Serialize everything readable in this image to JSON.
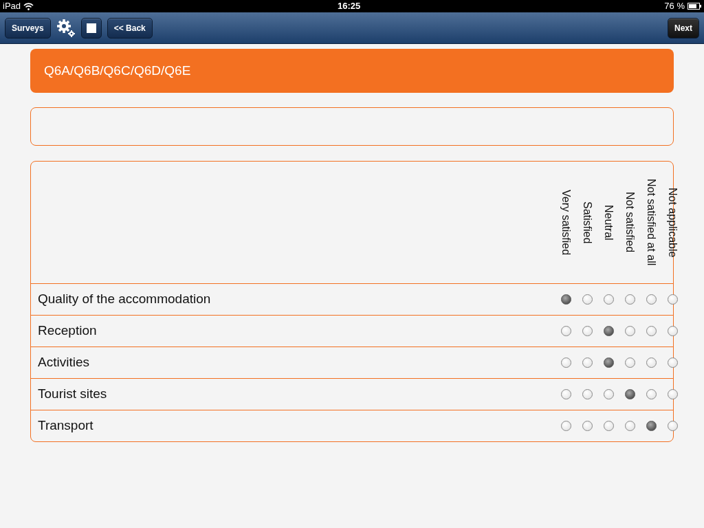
{
  "status_bar": {
    "device": "iPad",
    "time": "16:25",
    "battery": "76 %"
  },
  "toolbar": {
    "left_buttons": [
      {
        "kind": "text",
        "label": "Surveys"
      },
      {
        "kind": "gears"
      },
      {
        "kind": "square"
      },
      {
        "kind": "text",
        "label": "<< Back"
      }
    ],
    "right_buttons": [
      {
        "kind": "text",
        "label": "Next"
      }
    ]
  },
  "question": {
    "title": "Q6A/Q6B/Q6C/Q6D/Q6E"
  },
  "scale": [
    "Very satisfied",
    "Satisfied",
    "Neutral",
    "Not satisfied",
    "Not satisfied at all",
    "Not applicable"
  ],
  "rows": [
    {
      "label": "Quality of the accommodation",
      "choices": [
        {
          "selected": true
        },
        {
          "selected": false
        },
        {
          "selected": false
        },
        {
          "selected": false
        },
        {
          "selected": false
        },
        {
          "selected": false
        }
      ]
    },
    {
      "label": "Reception",
      "choices": [
        {
          "selected": false
        },
        {
          "selected": false
        },
        {
          "selected": true
        },
        {
          "selected": false
        },
        {
          "selected": false
        },
        {
          "selected": false
        }
      ]
    },
    {
      "label": "Activities",
      "choices": [
        {
          "selected": false
        },
        {
          "selected": false
        },
        {
          "selected": true
        },
        {
          "selected": false
        },
        {
          "selected": false
        },
        {
          "selected": false
        }
      ]
    },
    {
      "label": "Tourist sites",
      "choices": [
        {
          "selected": false
        },
        {
          "selected": false
        },
        {
          "selected": false
        },
        {
          "selected": true
        },
        {
          "selected": false
        },
        {
          "selected": false
        }
      ]
    },
    {
      "label": "Transport",
      "choices": [
        {
          "selected": false
        },
        {
          "selected": false
        },
        {
          "selected": false
        },
        {
          "selected": false
        },
        {
          "selected": true
        },
        {
          "selected": false
        }
      ]
    }
  ]
}
